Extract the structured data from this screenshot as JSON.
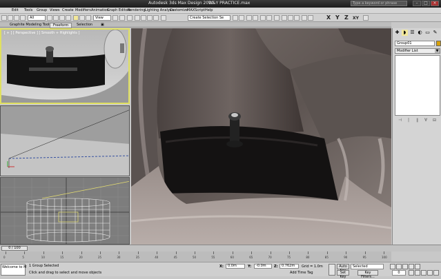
{
  "window": {
    "app_title": "Autodesk 3ds Max Design 2010",
    "file_title": "W&Y PRACTICE.max",
    "search_placeholder": "Type a keyword or phrase",
    "min": "–",
    "max": "□",
    "close": "×"
  },
  "menu": [
    "Edit",
    "Tools",
    "Group",
    "Views",
    "Create",
    "Modifiers",
    "Animation",
    "Graph Editors",
    "Rendering",
    "Lighting Analysis",
    "Customize",
    "MAXScript",
    "Help"
  ],
  "toolbar": {
    "filter_value": "All",
    "refcoord_value": "View",
    "named_sel_value": "Create Selection Se",
    "axis_x": "X",
    "axis_y": "Y",
    "axis_z": "Z",
    "axis_xy": "XY"
  },
  "ribbon": {
    "tabs": [
      "Graphite Modeling Tools",
      "Freeform",
      "Selection"
    ],
    "active": "Freeform",
    "toggle": "▣"
  },
  "viewports": {
    "top_left": "[ + ] [ Perspective ] [ Smooth + Highlights ]",
    "mid_left": "",
    "bottom_left": "",
    "main": ""
  },
  "command_panel": {
    "tabs": [
      "✚",
      "◗",
      "☰",
      "◐",
      "▭",
      "✎"
    ],
    "object_name": "Group01",
    "object_color": "#d7a10a",
    "modifier_list": "Modifier List",
    "modifier_arrow": "▼",
    "stack_icons": [
      "⊣",
      "|",
      "∥",
      "∀",
      "⊟"
    ]
  },
  "timeline": {
    "slider": "0 / 100",
    "ticks": [
      "0",
      "5",
      "10",
      "15",
      "20",
      "25",
      "30",
      "35",
      "40",
      "45",
      "50",
      "55",
      "60",
      "65",
      "70",
      "75",
      "80",
      "85",
      "90",
      "95",
      "100"
    ]
  },
  "status": {
    "maxscript": "Welcome to M",
    "selected": "1 Group Selected",
    "prompt": "Click and drag to select and move objects",
    "x_label": "X:",
    "x_value": "0.0m",
    "y_label": "Y:",
    "y_value": "-0.0m",
    "z_label": "Z:",
    "z_value": "0.762m",
    "grid": "Grid = 1.0m",
    "add_time_tag": "Add Time Tag",
    "auto_key": "Auto Key",
    "set_key": "Set Key",
    "selected_filter": "Selected",
    "key_filters": "Key Filters...",
    "frame": "0"
  }
}
